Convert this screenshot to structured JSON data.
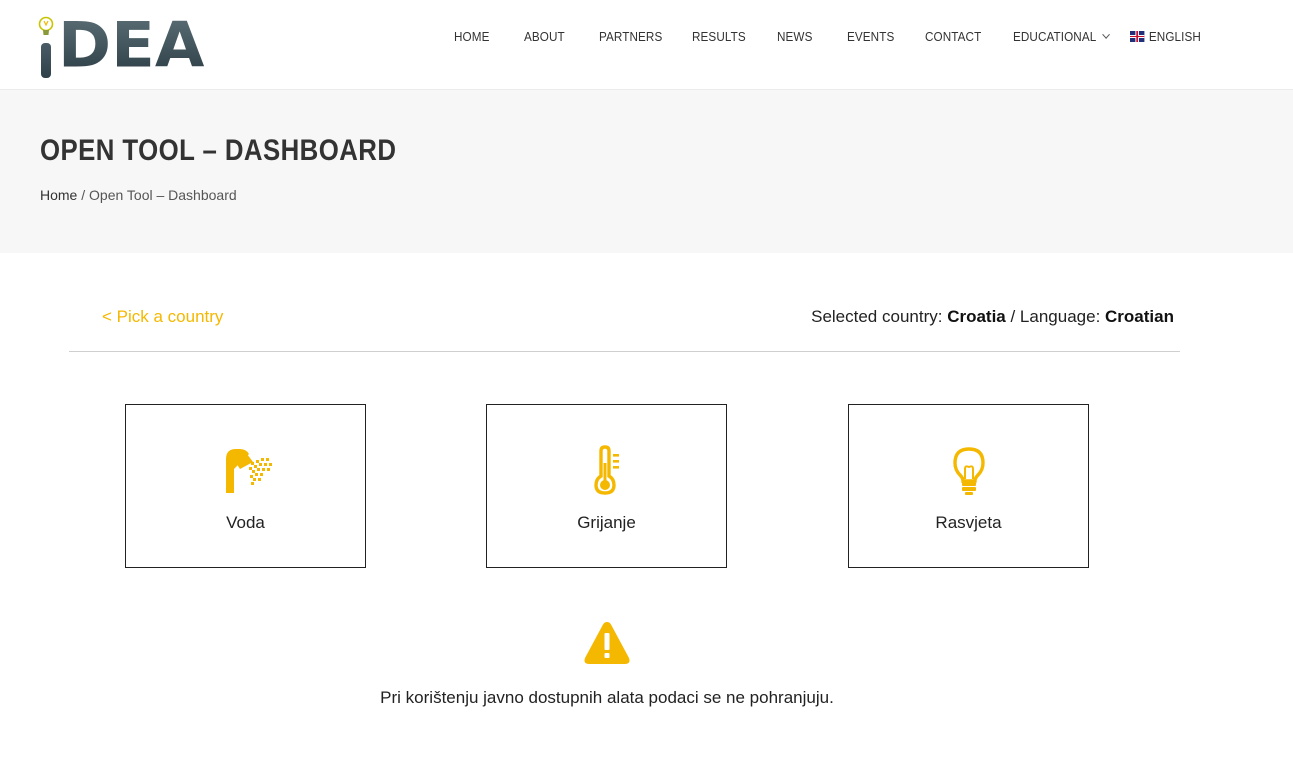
{
  "logo": {
    "text": "DEA"
  },
  "nav": {
    "items": [
      {
        "label": "HOME"
      },
      {
        "label": "ABOUT"
      },
      {
        "label": "PARTNERS"
      },
      {
        "label": "RESULTS"
      },
      {
        "label": "NEWS"
      },
      {
        "label": "EVENTS"
      },
      {
        "label": "CONTACT"
      },
      {
        "label": "EDUCATIONAL"
      }
    ],
    "language": "ENGLISH"
  },
  "page": {
    "title": "OPEN TOOL – DASHBOARD",
    "breadcrumb_home": "Home",
    "breadcrumb_separator": " / ",
    "breadcrumb_current": "Open Tool – Dashboard"
  },
  "country_bar": {
    "pick_link": "< Pick a country",
    "selected_country_label": "Selected country: ",
    "selected_country": "Croatia",
    "language_label": " / Language: ",
    "language": "Croatian"
  },
  "cards": [
    {
      "label": "Voda",
      "icon": "shower-icon"
    },
    {
      "label": "Grijanje",
      "icon": "thermometer-icon"
    },
    {
      "label": "Rasvjeta",
      "icon": "lightbulb-icon"
    }
  ],
  "notice": {
    "icon": "warning-icon",
    "text": "Pri korištenju javno dostupnih alata podaci se ne pohranjuju."
  },
  "colors": {
    "accent": "#f5b800",
    "title_band": "#f7f7f7",
    "logo": "#3b4f58"
  }
}
